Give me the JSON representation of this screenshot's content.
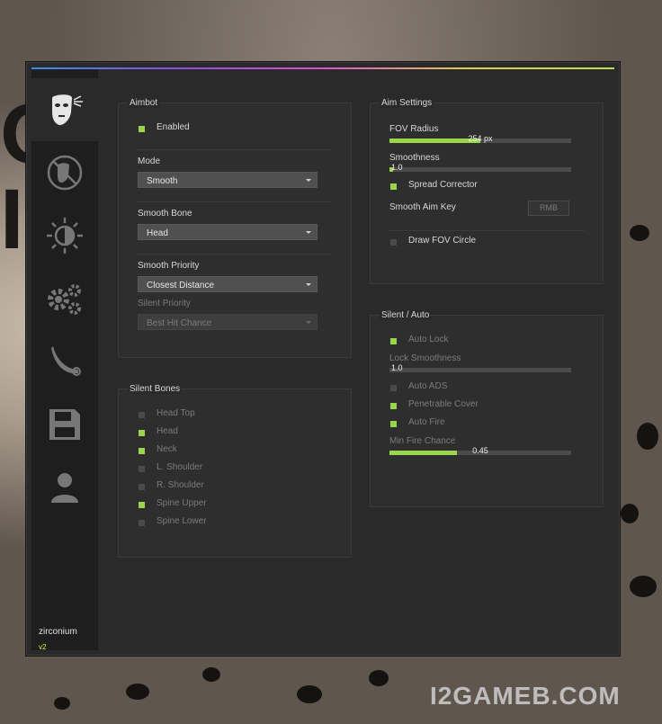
{
  "window": {
    "brand": "zirconium",
    "version": "v2"
  },
  "sidebar": {
    "items": [
      {
        "name": "aimbot",
        "icon": "aim-face-icon",
        "active": true
      },
      {
        "name": "triggerbot",
        "icon": "no-aim-icon"
      },
      {
        "name": "visuals",
        "icon": "brightness-icon"
      },
      {
        "name": "misc",
        "icon": "gears-icon"
      },
      {
        "name": "skins",
        "icon": "knife-icon"
      },
      {
        "name": "config",
        "icon": "save-icon"
      },
      {
        "name": "players",
        "icon": "user-icon"
      }
    ]
  },
  "aimbot": {
    "title": "Aimbot",
    "enabled_label": "Enabled",
    "enabled": true,
    "mode_label": "Mode",
    "mode_value": "Smooth",
    "smooth_bone_label": "Smooth Bone",
    "smooth_bone_value": "Head",
    "smooth_priority_label": "Smooth Priority",
    "smooth_priority_value": "Closest Distance",
    "silent_priority_label": "Silent Priority",
    "silent_priority_value": "Best Hit Chance"
  },
  "silent_bones": {
    "title": "Silent Bones",
    "items": [
      {
        "label": "Head Top",
        "checked": false
      },
      {
        "label": "Head",
        "checked": true
      },
      {
        "label": "Neck",
        "checked": true
      },
      {
        "label": "L. Shoulder",
        "checked": false
      },
      {
        "label": "R. Shoulder",
        "checked": false
      },
      {
        "label": "Spine Upper",
        "checked": true
      },
      {
        "label": "Spine Lower",
        "checked": false
      }
    ]
  },
  "aim_settings": {
    "title": "Aim Settings",
    "fov_label": "FOV Radius",
    "fov_value": "254 px",
    "fov_fraction": 0.5,
    "smooth_label": "Smoothness",
    "smooth_value": "1.0",
    "smooth_fraction": 0.02,
    "spread_label": "Spread Corrector",
    "spread": true,
    "key_label": "Smooth Aim Key",
    "key_value": "RMB",
    "draw_fov_label": "Draw FOV Circle",
    "draw_fov": false
  },
  "silent_auto": {
    "title": "Silent / Auto",
    "auto_lock_label": "Auto Lock",
    "auto_lock": true,
    "lock_smooth_label": "Lock Smoothness",
    "lock_smooth_value": "1.0",
    "lock_smooth_fraction": 0.0,
    "auto_ads_label": "Auto ADS",
    "auto_ads": false,
    "penetrable_label": "Penetrable Cover",
    "penetrable": true,
    "auto_fire_label": "Auto Fire",
    "auto_fire": true,
    "min_fire_label": "Min Fire Chance",
    "min_fire_value": "0.45",
    "min_fire_fraction": 0.37
  },
  "watermark": "I2GAMEB.COM",
  "colors": {
    "accent": "#9ad64a",
    "panel": "#2a2a2a",
    "sidebar": "#1e1e1e"
  }
}
